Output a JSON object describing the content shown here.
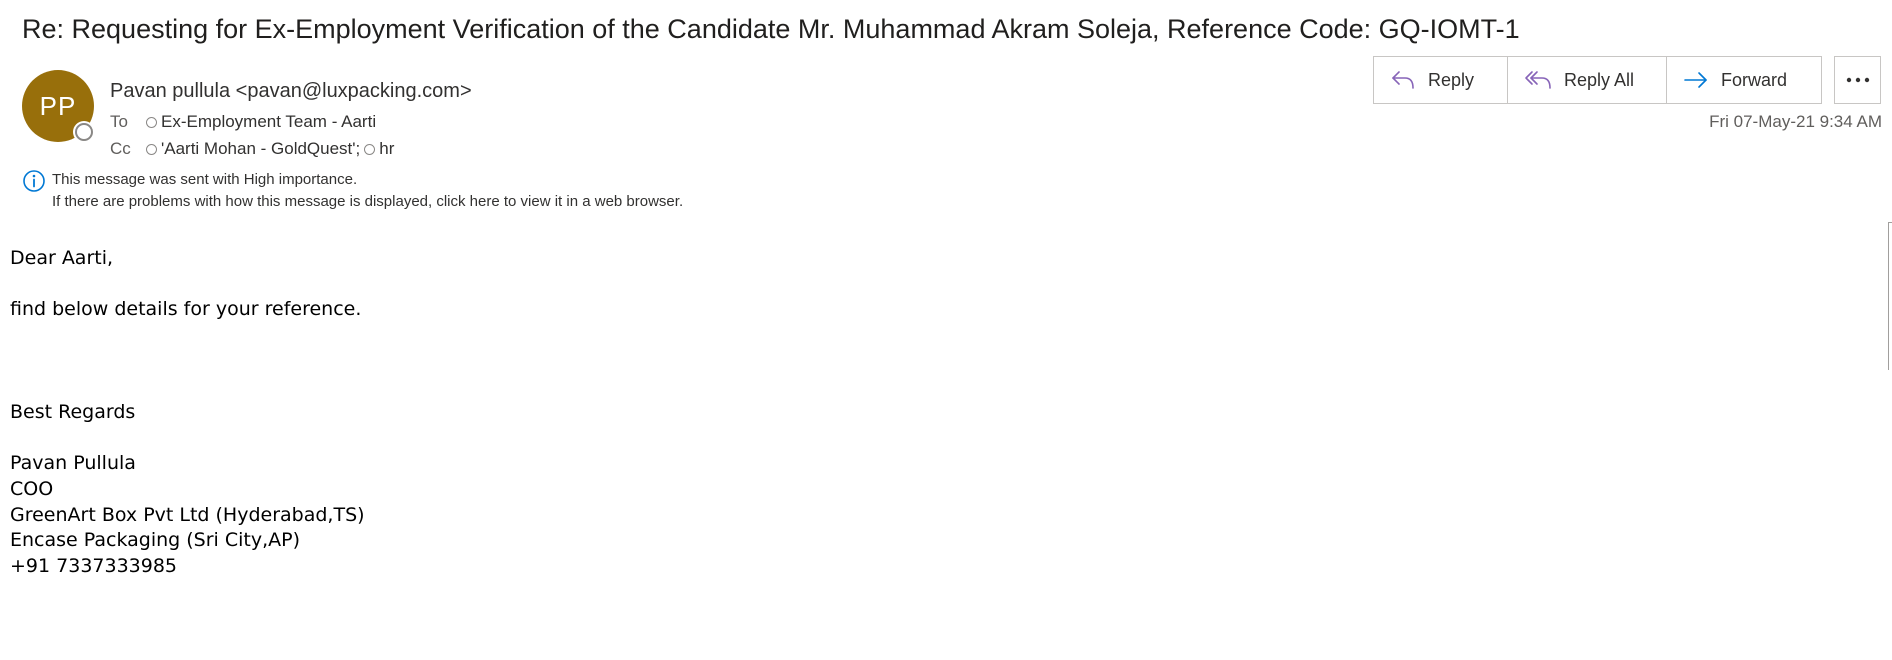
{
  "email": {
    "subject": "Re: Requesting for Ex-Employment Verification of the Candidate Mr. Muhammad Akram Soleja, Reference Code: GQ-IOMT-1",
    "avatar_initials": "PP",
    "sender": "Pavan pullula <pavan@luxpacking.com>",
    "to_label": "To",
    "to_recipients": [
      "Ex-Employment Team - Aarti"
    ],
    "cc_label": "Cc",
    "cc_recipients": [
      "'Aarti Mohan - GoldQuest';",
      "hr"
    ],
    "date": "Fri 07-May-21 9:34 AM",
    "importance_note": "This message was sent with High importance.",
    "display_note": "If there are problems with how this message is displayed, click here to view it in a web browser."
  },
  "actions": {
    "reply": "Reply",
    "reply_all": "Reply All",
    "forward": "Forward",
    "more_icon": "more-icon"
  },
  "body": {
    "greeting": "Dear Aarti,",
    "line1": "find below details for your reference.",
    "closing": "Best Regards",
    "sig_name": "Pavan Pullula",
    "sig_title": "COO",
    "sig_company1": "GreenArt Box Pvt Ltd (Hyderabad,TS)",
    "sig_company2": "Encase Packaging (Sri City,AP)",
    "sig_phone": "+91 7337333985"
  },
  "colors": {
    "avatar_bg": "#986f0b",
    "accent_purple": "#8764b8",
    "accent_blue": "#0078d4"
  }
}
